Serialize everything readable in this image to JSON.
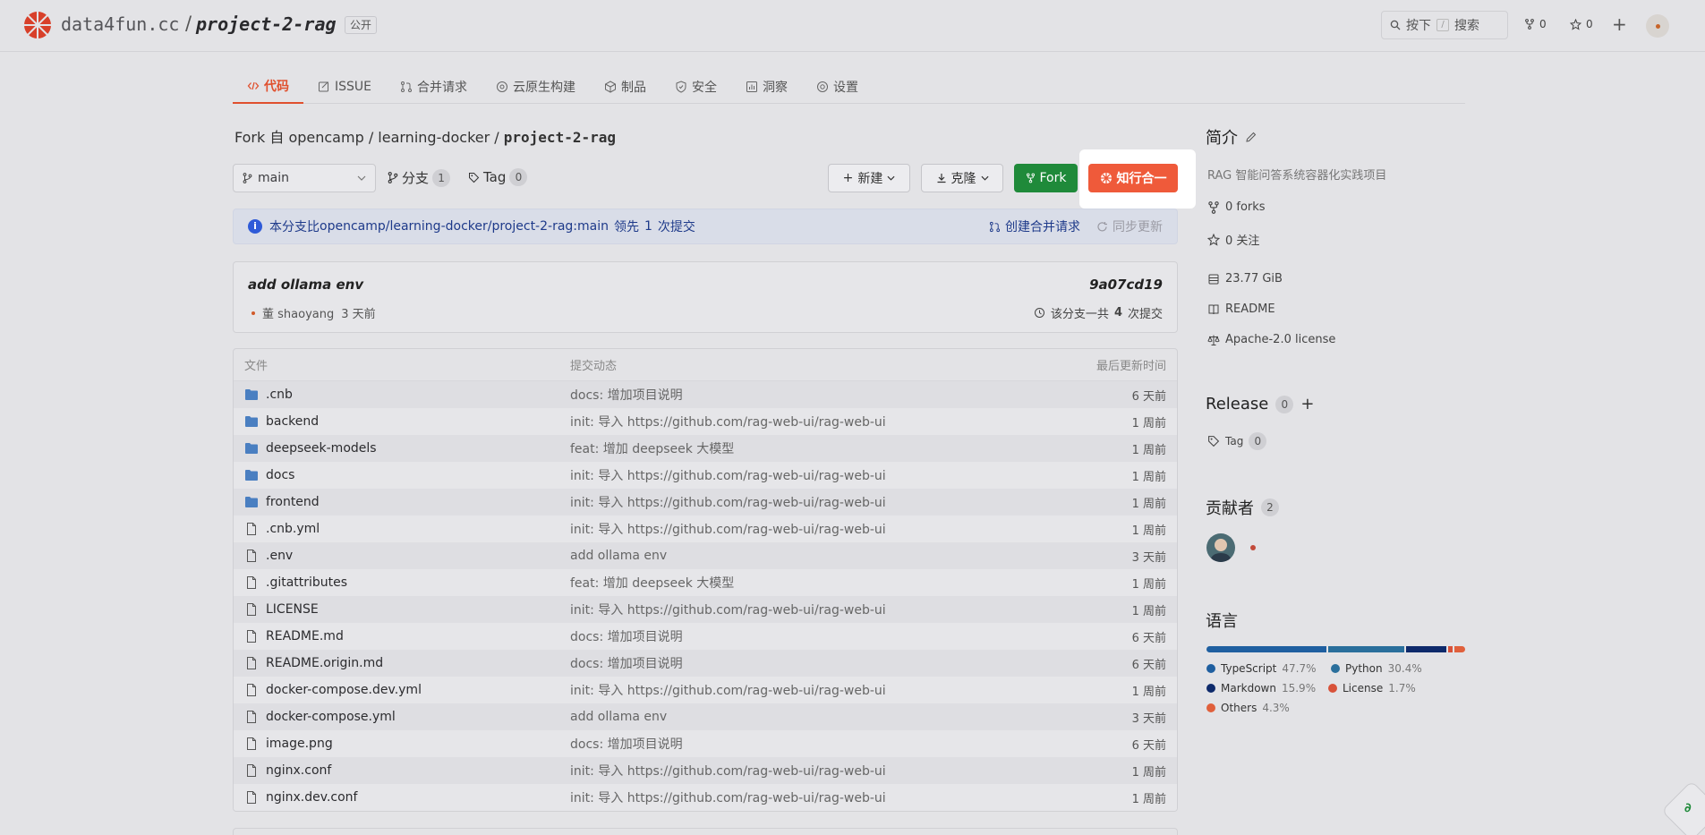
{
  "header": {
    "org": "data4fun.cc",
    "slash": "/",
    "repo": "project-2-rag",
    "visibility": "公开",
    "search_key": "按下",
    "search_shortcut": "/",
    "search_label": "搜索",
    "forks_count": "0",
    "stars_count": "0"
  },
  "tabs": [
    {
      "label": "代码",
      "icon": "code-icon",
      "active": true
    },
    {
      "label": "ISSUE",
      "icon": "issue-icon"
    },
    {
      "label": "合并请求",
      "icon": "pull-request-icon"
    },
    {
      "label": "云原生构建",
      "icon": "build-icon"
    },
    {
      "label": "制品",
      "icon": "package-icon"
    },
    {
      "label": "安全",
      "icon": "shield-icon"
    },
    {
      "label": "洞察",
      "icon": "insights-icon"
    },
    {
      "label": "设置",
      "icon": "gear-icon"
    }
  ],
  "fork": {
    "prefix": "Fork 自",
    "path": "opencamp / learning-docker /",
    "repo": "project-2-rag"
  },
  "toolbar": {
    "branch": "main",
    "branches_label": "分支",
    "branches_count": "1",
    "tag_label": "Tag",
    "tag_count": "0",
    "new_label": "新建",
    "clone_label": "克隆",
    "fork_label": "Fork",
    "zhixing_label": "知行合一"
  },
  "banner": {
    "prefix": "本分支比",
    "ref": "opencamp/learning-docker/project-2-rag:main",
    "ahead": "领先",
    "count": "1",
    "suffix": "次提交",
    "create_pr": "创建合并请求",
    "sync": "同步更新"
  },
  "commit": {
    "message": "add ollama env",
    "hash": "9a07cd19",
    "author": "董 shaoyang",
    "time": "3 天前",
    "total_prefix": "该分支一共",
    "total_count": "4",
    "total_suffix": "次提交"
  },
  "files_header": {
    "name": "文件",
    "msg": "提交动态",
    "time": "最后更新时间"
  },
  "files": [
    {
      "name": ".cnb",
      "type": "folder",
      "msg": "docs: 增加项目说明",
      "time": "6 天前"
    },
    {
      "name": "backend",
      "type": "folder",
      "msg": "init: 导入 https://github.com/rag-web-ui/rag-web-ui",
      "time": "1 周前"
    },
    {
      "name": "deepseek-models",
      "type": "folder",
      "msg": "feat: 增加 deepseek 大模型",
      "time": "1 周前"
    },
    {
      "name": "docs",
      "type": "folder",
      "msg": "init: 导入 https://github.com/rag-web-ui/rag-web-ui",
      "time": "1 周前"
    },
    {
      "name": "frontend",
      "type": "folder",
      "msg": "init: 导入 https://github.com/rag-web-ui/rag-web-ui",
      "time": "1 周前"
    },
    {
      "name": ".cnb.yml",
      "type": "file",
      "msg": "init: 导入 https://github.com/rag-web-ui/rag-web-ui",
      "time": "1 周前"
    },
    {
      "name": ".env",
      "type": "file",
      "msg": "add ollama env",
      "time": "3 天前"
    },
    {
      "name": ".gitattributes",
      "type": "file",
      "msg": "feat: 增加 deepseek 大模型",
      "time": "1 周前"
    },
    {
      "name": "LICENSE",
      "type": "file",
      "msg": "init: 导入 https://github.com/rag-web-ui/rag-web-ui",
      "time": "1 周前"
    },
    {
      "name": "README.md",
      "type": "file",
      "msg": "docs: 增加项目说明",
      "time": "6 天前"
    },
    {
      "name": "README.origin.md",
      "type": "file",
      "msg": "docs: 增加项目说明",
      "time": "6 天前"
    },
    {
      "name": "docker-compose.dev.yml",
      "type": "file",
      "msg": "init: 导入 https://github.com/rag-web-ui/rag-web-ui",
      "time": "1 周前"
    },
    {
      "name": "docker-compose.yml",
      "type": "file",
      "msg": "add ollama env",
      "time": "3 天前"
    },
    {
      "name": "image.png",
      "type": "file",
      "msg": "docs: 增加项目说明",
      "time": "6 天前"
    },
    {
      "name": "nginx.conf",
      "type": "file",
      "msg": "init: 导入 https://github.com/rag-web-ui/rag-web-ui",
      "time": "1 周前"
    },
    {
      "name": "nginx.dev.conf",
      "type": "file",
      "msg": "init: 导入 https://github.com/rag-web-ui/rag-web-ui",
      "time": "1 周前"
    }
  ],
  "sidebar": {
    "intro_title": "简介",
    "description": "RAG 智能问答系统容器化实践项目",
    "forks": "0 forks",
    "stars": "0 关注",
    "size": "23.77 GiB",
    "readme": "README",
    "license": "Apache-2.0 license",
    "release_title": "Release",
    "release_count": "0",
    "tag_label": "Tag",
    "tag_count": "0",
    "contributors_title": "贡献者",
    "contributors_count": "2",
    "languages_title": "语言",
    "languages": [
      {
        "name": "TypeScript",
        "pct": "47.7%",
        "value": 47.7,
        "color": "#1f5fa0"
      },
      {
        "name": "Python",
        "pct": "30.4%",
        "value": 30.4,
        "color": "#2a6f9c"
      },
      {
        "name": "Markdown",
        "pct": "15.9%",
        "value": 15.9,
        "color": "#0e2a6b"
      },
      {
        "name": "License",
        "pct": "1.7%",
        "value": 1.7,
        "color": "#d8523a"
      },
      {
        "name": "Others",
        "pct": "4.3%",
        "value": 4.3,
        "color": "#e0603c"
      }
    ]
  },
  "colors": {
    "accent": "#e0502e",
    "fork_green": "#1f8a3a",
    "brand_red": "#ef5a3a"
  }
}
